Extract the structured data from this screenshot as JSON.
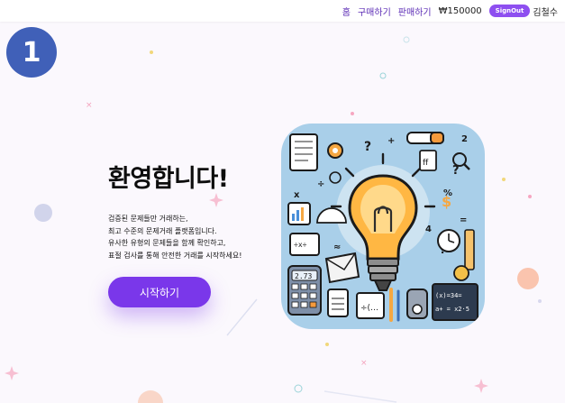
{
  "nav": {
    "home": "홈",
    "buy": "구매하기",
    "sell": "판매하기",
    "balance": "₩150000",
    "signout": "SignOut",
    "username": "김철수"
  },
  "step": "1",
  "hero": {
    "title": "환영합니다!",
    "desc_lines": [
      "검증된 문제들만 거래하는,",
      "최고 수준의 문제거래 플랫폼입니다.",
      "유사한 유형의 문제들을 함께 확인하고,",
      "표절 검사를 통해 안전한 거래를 시작하세요!"
    ],
    "button": "시작하기"
  },
  "colors": {
    "accent": "#7a37ea",
    "badge": "#4060b8",
    "nav_link": "#5b2bb5",
    "image_bg": "#a9cfe9"
  },
  "image": {
    "icon": "lightbulb-icon",
    "labels": [
      "?",
      "2.73",
      "÷x÷",
      "(x)=34=",
      "a+ = x2·5"
    ]
  }
}
